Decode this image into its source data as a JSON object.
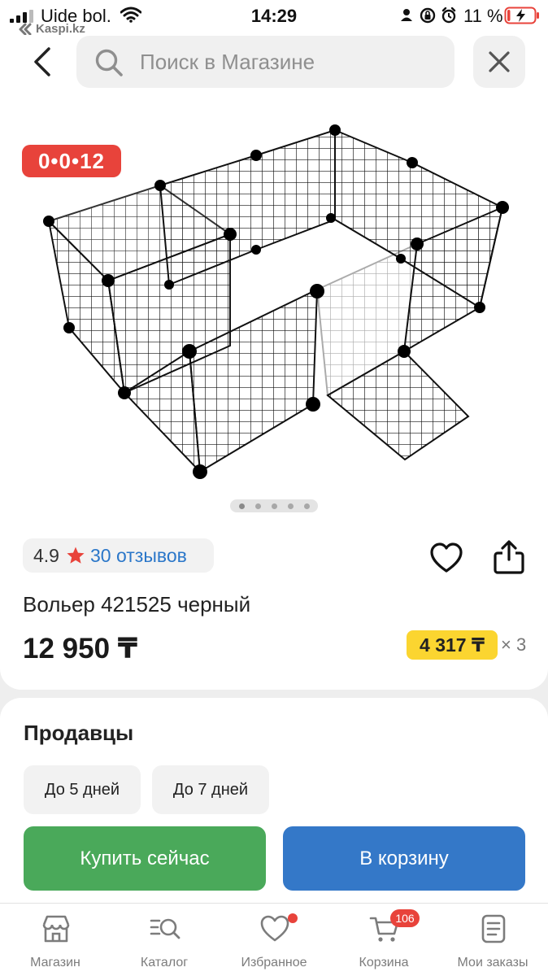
{
  "status_bar": {
    "carrier": "Uide bol.",
    "source_app": "Kaspi.kz",
    "time": "14:29",
    "battery_percent": "11 %",
    "battery_level": 0.11,
    "colors": {
      "battery_charging": "#e8433b"
    }
  },
  "search": {
    "placeholder": "Поиск в Магазине",
    "back_icon": "chevron-left-icon",
    "clear_icon": "close-icon"
  },
  "product": {
    "timer": "0•0•12",
    "image_index": 1,
    "image_count": 5,
    "rating": "4.9",
    "reviews_label": "30 отзывов",
    "title": "Вольер 421525 черный",
    "price": "12 950 ₸",
    "installment_price": "4 317 ₸",
    "installment_months": "× 3"
  },
  "sellers": {
    "title": "Продавцы",
    "delivery_options": [
      "До 5 дней",
      "До 7 дней"
    ],
    "buy_now_label": "Купить сейчас",
    "add_to_cart_label": "В корзину"
  },
  "tab_bar": {
    "tabs": [
      {
        "label": "Магазин",
        "icon": "store-icon"
      },
      {
        "label": "Каталог",
        "icon": "catalog-search-icon"
      },
      {
        "label": "Избранное",
        "icon": "heart-icon"
      },
      {
        "label": "Корзина",
        "icon": "cart-icon",
        "badge": "106"
      },
      {
        "label": "Мои заказы",
        "icon": "orders-icon"
      }
    ]
  },
  "colors": {
    "timer_badge": "#e8433b",
    "installment_badge": "#fbd530",
    "buy_now": "#4aa95a",
    "add_to_cart": "#3478c8",
    "link": "#2b77c9",
    "rating_star": "#e8433b"
  }
}
